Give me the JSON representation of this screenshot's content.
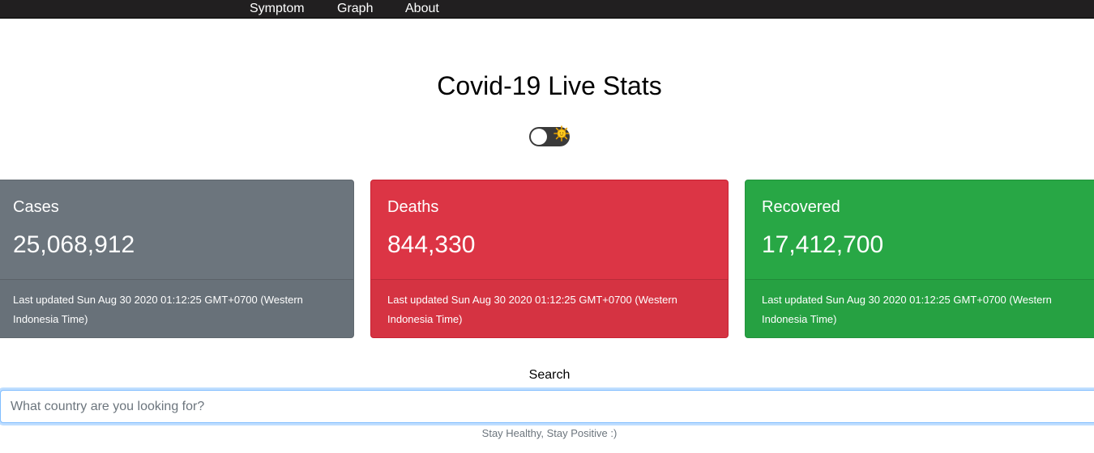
{
  "nav": {
    "items": [
      {
        "label": "Symptom"
      },
      {
        "label": "Graph"
      },
      {
        "label": "About"
      }
    ]
  },
  "header": {
    "title": "Covid-19 Live Stats"
  },
  "theme_toggle": {
    "icon": "sun-icon",
    "state": "off"
  },
  "cards": {
    "cases": {
      "title": "Cases",
      "value": "25,068,912",
      "footer": "Last updated Sun Aug 30 2020 01:12:25 GMT+0700 (Western Indonesia Time)",
      "color": "#6c757d"
    },
    "deaths": {
      "title": "Deaths",
      "value": "844,330",
      "footer": "Last updated Sun Aug 30 2020 01:12:25 GMT+0700 (Western Indonesia Time)",
      "color": "#dc3545"
    },
    "recovered": {
      "title": "Recovered",
      "value": "17,412,700",
      "footer": "Last updated Sun Aug 30 2020 01:12:25 GMT+0700 (Western Indonesia Time)",
      "color": "#28a745"
    }
  },
  "search": {
    "label": "Search",
    "placeholder": "What country are you looking for?",
    "value": ""
  },
  "footer": {
    "note": "Stay Healthy, Stay Positive :)"
  }
}
